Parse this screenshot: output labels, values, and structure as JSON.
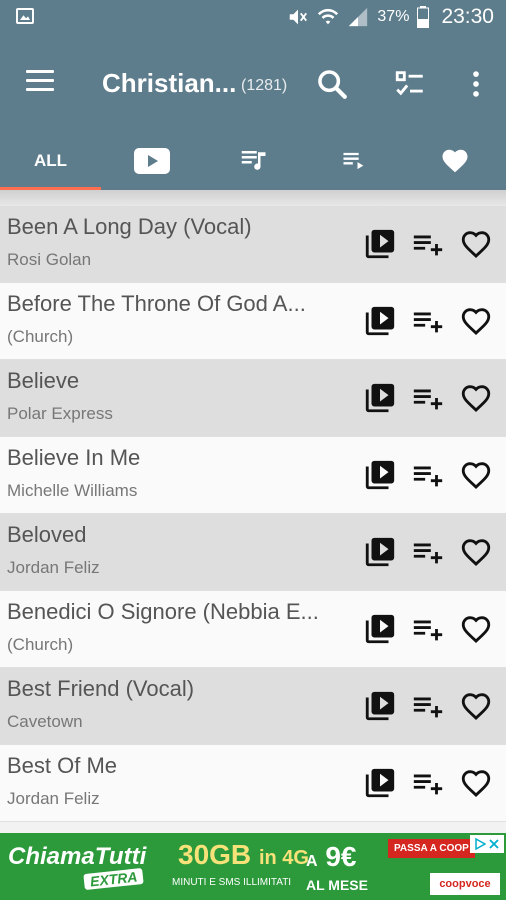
{
  "statusbar": {
    "battery": "37%",
    "time": "23:30"
  },
  "toolbar": {
    "title": "Christian...",
    "count": "(1281)"
  },
  "tabs": [
    {
      "label": "ALL"
    }
  ],
  "songs": [
    {
      "title": "Been A Long Day (Vocal)",
      "artist": "Rosi Golan"
    },
    {
      "title": "Before The Throne Of God A...",
      "artist": "(Church)"
    },
    {
      "title": "Believe",
      "artist": "Polar Express"
    },
    {
      "title": "Believe In Me",
      "artist": "Michelle Williams"
    },
    {
      "title": "Beloved",
      "artist": "Jordan Feliz"
    },
    {
      "title": "Benedici O Signore (Nebbia E...",
      "artist": "(Church)"
    },
    {
      "title": "Best Friend (Vocal)",
      "artist": "Cavetown"
    },
    {
      "title": "Best Of Me",
      "artist": "Jordan Feliz"
    }
  ],
  "ad": {
    "brand": "ChiamaTutti",
    "extra": "EXTRA",
    "data": "30GB",
    "network": "in 4G",
    "sub": "MINUTI E SMS ILLIMITATI",
    "prefix": "A",
    "price": "9€",
    "period": "AL MESE",
    "cta": "PASSA A COOP",
    "operator": "coopvoce"
  },
  "colors": {
    "primary": "#5e7d8c",
    "accent": "#ff6f4f",
    "ad_green": "#2c9a3b"
  }
}
